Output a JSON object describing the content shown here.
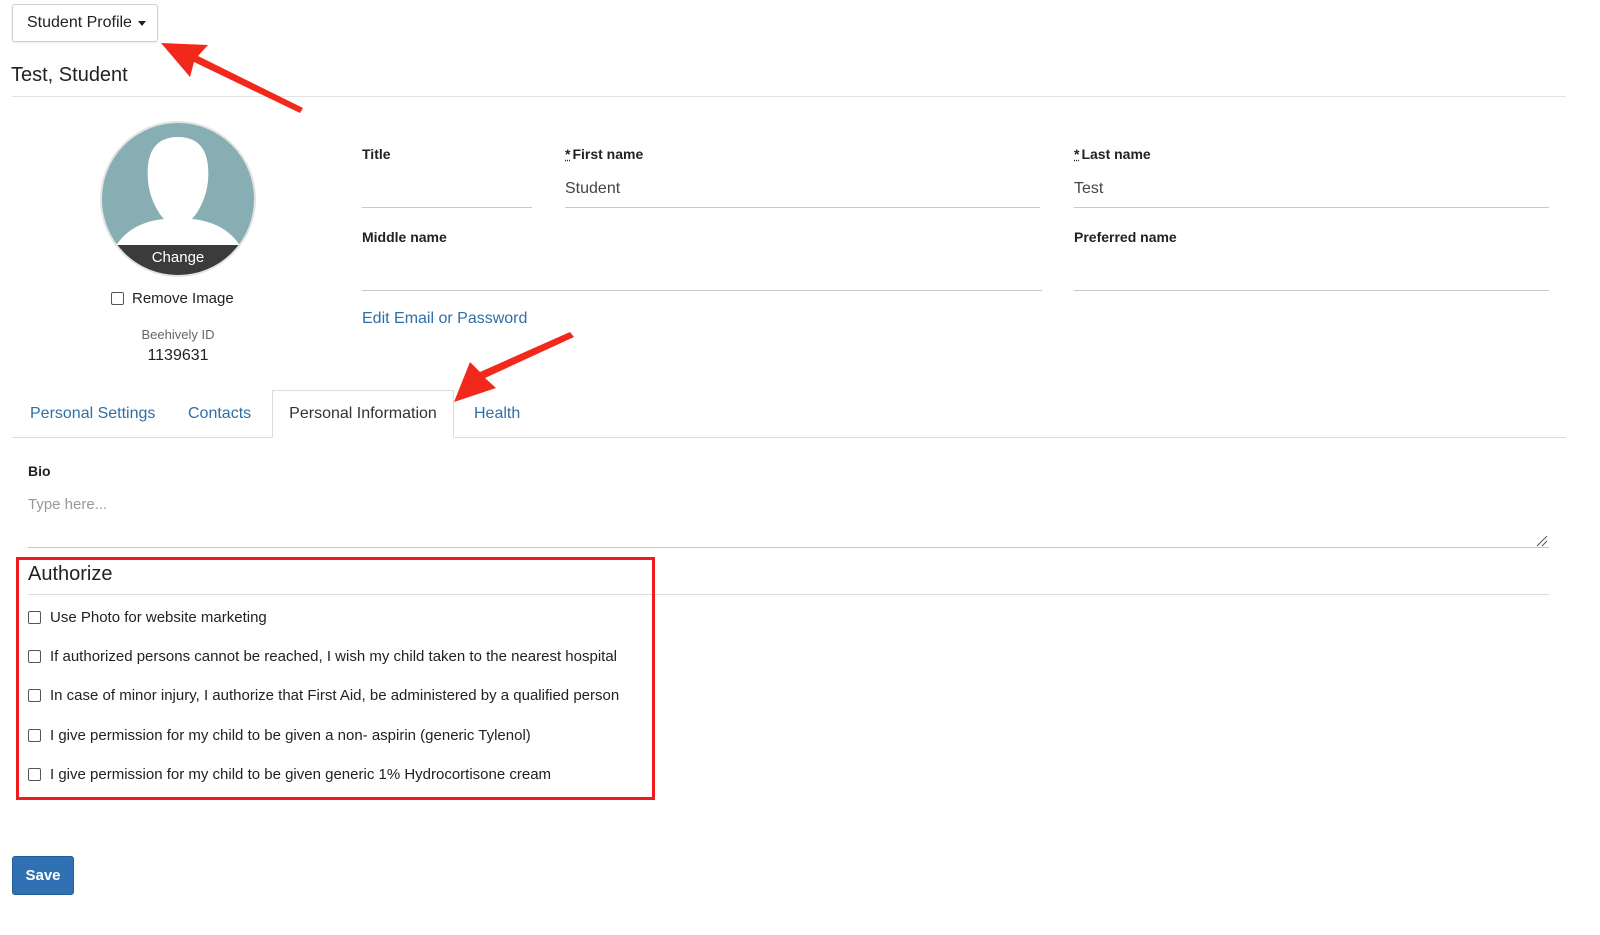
{
  "header": {
    "profile_dropdown_label": "Student Profile",
    "student_name": "Test, Student"
  },
  "avatar": {
    "change_label": "Change",
    "remove_image_label": "Remove Image",
    "beehively_id_label": "Beehively ID",
    "beehively_id": "1139631"
  },
  "form": {
    "title_label": "Title",
    "title_value": "",
    "first_name_label": "First name",
    "first_name_value": "Student",
    "last_name_label": "Last name",
    "last_name_value": "Test",
    "middle_name_label": "Middle name",
    "middle_name_value": "",
    "preferred_name_label": "Preferred name",
    "preferred_name_value": "",
    "required_marker": "*",
    "edit_email_link": "Edit Email or Password"
  },
  "tabs": [
    {
      "label": "Personal Settings",
      "active": false
    },
    {
      "label": "Contacts",
      "active": false
    },
    {
      "label": "Personal Information",
      "active": true
    },
    {
      "label": "Health",
      "active": false
    }
  ],
  "bio": {
    "label": "Bio",
    "placeholder": "Type here..."
  },
  "authorize": {
    "title": "Authorize",
    "items": [
      {
        "label": "Use Photo for website marketing",
        "checked": false
      },
      {
        "label": "If authorized persons cannot be reached, I wish my child taken to the nearest hospital",
        "checked": false
      },
      {
        "label": "In case of minor injury, I authorize that First Aid, be administered by a qualified person",
        "checked": false
      },
      {
        "label": "I give permission for my child to be given a non- aspirin (generic Tylenol)",
        "checked": false
      },
      {
        "label": "I give permission for my child to be given generic 1% Hydrocortisone cream",
        "checked": false
      }
    ]
  },
  "footer": {
    "save_label": "Save"
  },
  "colors": {
    "link": "#2f6fa6",
    "save_button": "#2f71b2",
    "highlight_box": "#ee1c1c",
    "annotation_arrow": "#f2281c",
    "avatar_bg": "#86aeb3"
  },
  "icons": {
    "dropdown": "caret-down-icon",
    "avatar": "user-silhouette-icon",
    "annotation": "arrow-annotation-icon"
  }
}
